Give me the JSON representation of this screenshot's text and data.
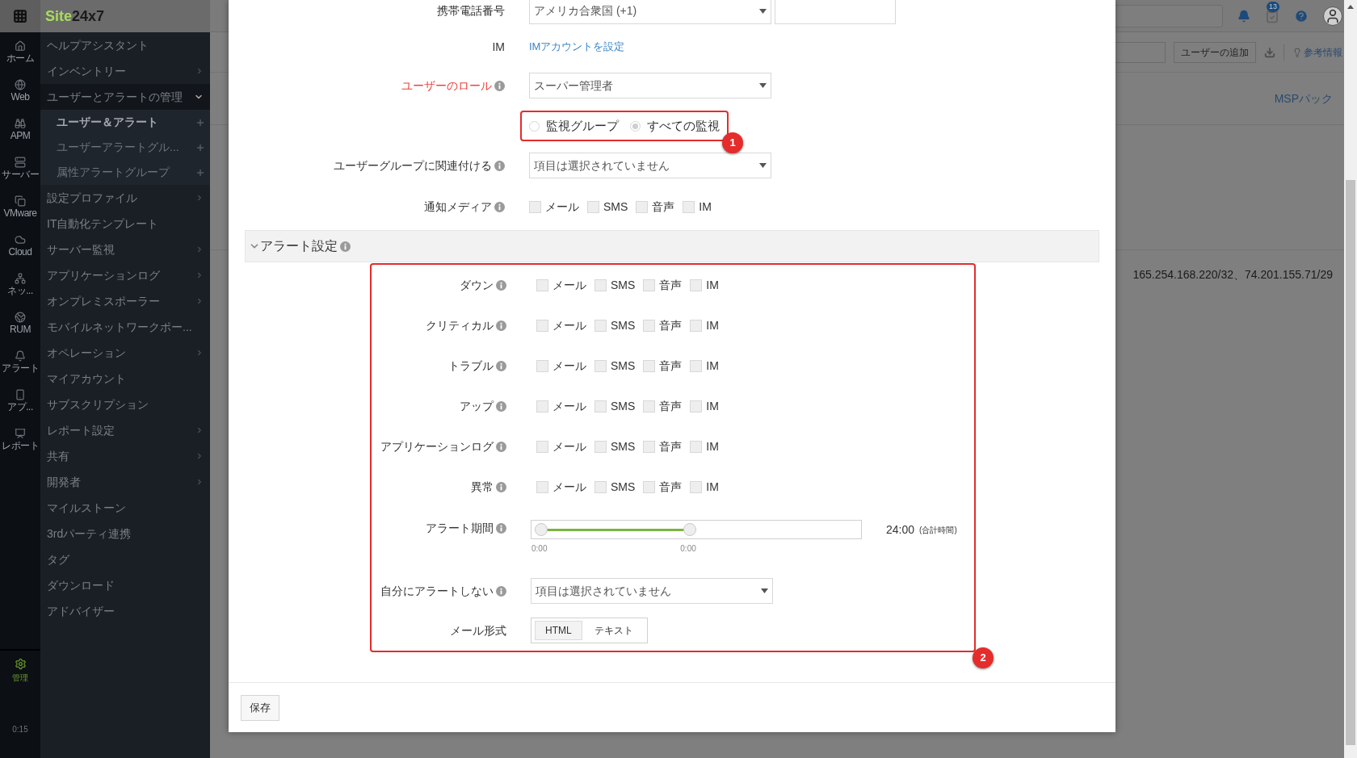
{
  "app": {
    "logo_first": "Site",
    "logo_second": "24x7",
    "time": "0:15"
  },
  "rail": [
    {
      "label": "ホーム",
      "selected": false
    },
    {
      "label": "Web",
      "selected": false
    },
    {
      "label": "APM",
      "selected": false
    },
    {
      "label": "サーバー",
      "selected": false
    },
    {
      "label": "VMware",
      "selected": false
    },
    {
      "label": "Cloud",
      "selected": false
    },
    {
      "label": "ネッ...",
      "selected": false
    },
    {
      "label": "RUM",
      "selected": false
    },
    {
      "label": "アラート",
      "selected": false
    },
    {
      "label": "アプ...",
      "selected": false
    },
    {
      "label": "レポート",
      "selected": false
    }
  ],
  "rail_bottom": {
    "label": "管理",
    "selected": true
  },
  "sidebar": {
    "items": [
      {
        "label": "ヘルプアシスタント",
        "has_submenu": false
      },
      {
        "label": "インベントリー",
        "has_submenu": true
      },
      {
        "label": "ユーザーとアラートの管理",
        "has_submenu": true,
        "expanded": true,
        "children": [
          {
            "label": "ユーザー＆アラート",
            "selected": true
          },
          {
            "label": "ユーザーアラートグル...",
            "selected": false
          },
          {
            "label": "属性アラートグループ",
            "selected": false
          }
        ]
      },
      {
        "label": "設定プロファイル",
        "has_submenu": true
      },
      {
        "label": "IT自動化テンプレート",
        "has_submenu": false
      },
      {
        "label": "サーバー監視",
        "has_submenu": true
      },
      {
        "label": "アプリケーションログ",
        "has_submenu": true
      },
      {
        "label": "オンプレミスポーラー",
        "has_submenu": true
      },
      {
        "label": "モバイルネットワークポー...",
        "has_submenu": false
      },
      {
        "label": "オペレーション",
        "has_submenu": true
      },
      {
        "label": "マイアカウント",
        "has_submenu": false
      },
      {
        "label": "サブスクリプション",
        "has_submenu": false
      },
      {
        "label": "レポート設定",
        "has_submenu": true
      },
      {
        "label": "共有",
        "has_submenu": true
      },
      {
        "label": "開発者",
        "has_submenu": true
      },
      {
        "label": "マイルストーン",
        "has_submenu": false
      },
      {
        "label": "3rdパーティ連携",
        "has_submenu": false
      },
      {
        "label": "タグ",
        "has_submenu": false
      },
      {
        "label": "ダウンロード",
        "has_submenu": false
      },
      {
        "label": "アドバイザー",
        "has_submenu": false
      }
    ]
  },
  "header": {
    "task_count": "13",
    "add_user": "ユーザーの追加",
    "reference": "参考情報",
    "msp": "MSPパック",
    "ip_text": "165.254.168.220/32、74.201.155.71/29"
  },
  "form": {
    "mobile": {
      "label": "携帯電話番号",
      "country": "アメリカ合衆国 (+1)"
    },
    "im": {
      "label": "IM",
      "link": "IMアカウントを設定"
    },
    "role": {
      "label": "ユーザーのロール",
      "required": true,
      "value": "スーパー管理者"
    },
    "scope": {
      "callout": "1",
      "options": [
        {
          "label": "監視グループ",
          "selected": false
        },
        {
          "label": "すべての監視",
          "selected": true
        }
      ]
    },
    "user_group": {
      "label": "ユーザーグループに関連付ける",
      "value": "項目は選択されていません"
    },
    "notify_media": {
      "label": "通知メディア",
      "options": [
        {
          "label": "メール",
          "checked": false
        },
        {
          "label": "SMS",
          "checked": false
        },
        {
          "label": "音声",
          "checked": false
        },
        {
          "label": "IM",
          "checked": false
        }
      ]
    }
  },
  "alert_settings": {
    "title": "アラート設定",
    "expanded": true,
    "callout": "2",
    "rows": [
      {
        "label": "ダウン",
        "options": [
          {
            "label": "メール",
            "checked": false
          },
          {
            "label": "SMS",
            "checked": false
          },
          {
            "label": "音声",
            "checked": false
          },
          {
            "label": "IM",
            "checked": false
          }
        ]
      },
      {
        "label": "クリティカル",
        "options": [
          {
            "label": "メール",
            "checked": false
          },
          {
            "label": "SMS",
            "checked": false
          },
          {
            "label": "音声",
            "checked": false
          },
          {
            "label": "IM",
            "checked": false
          }
        ]
      },
      {
        "label": "トラブル",
        "options": [
          {
            "label": "メール",
            "checked": false
          },
          {
            "label": "SMS",
            "checked": false
          },
          {
            "label": "音声",
            "checked": false
          },
          {
            "label": "IM",
            "checked": false
          }
        ]
      },
      {
        "label": "アップ",
        "options": [
          {
            "label": "メール",
            "checked": false
          },
          {
            "label": "SMS",
            "checked": false
          },
          {
            "label": "音声",
            "checked": false
          },
          {
            "label": "IM",
            "checked": false
          }
        ]
      },
      {
        "label": "アプリケーションログ",
        "options": [
          {
            "label": "メール",
            "checked": false
          },
          {
            "label": "SMS",
            "checked": false
          },
          {
            "label": "音声",
            "checked": false
          },
          {
            "label": "IM",
            "checked": false
          }
        ]
      },
      {
        "label": "異常",
        "options": [
          {
            "label": "メール",
            "checked": false
          },
          {
            "label": "SMS",
            "checked": false
          },
          {
            "label": "音声",
            "checked": false
          },
          {
            "label": "IM",
            "checked": false
          }
        ]
      }
    ],
    "period": {
      "label": "アラート期間",
      "start": {
        "level": 0,
        "reading": "0:00"
      },
      "end": {
        "level": 0.48,
        "reading": "0:00"
      },
      "total": "24:00",
      "total_note": "(合計時間)"
    },
    "no_alert": {
      "label": "自分にアラートしない",
      "value": "項目は選択されていません"
    },
    "mail_format": {
      "label": "メール形式",
      "options": [
        {
          "label": "HTML",
          "selected": true
        },
        {
          "label": "テキスト",
          "selected": false
        }
      ]
    }
  },
  "save": "保存"
}
